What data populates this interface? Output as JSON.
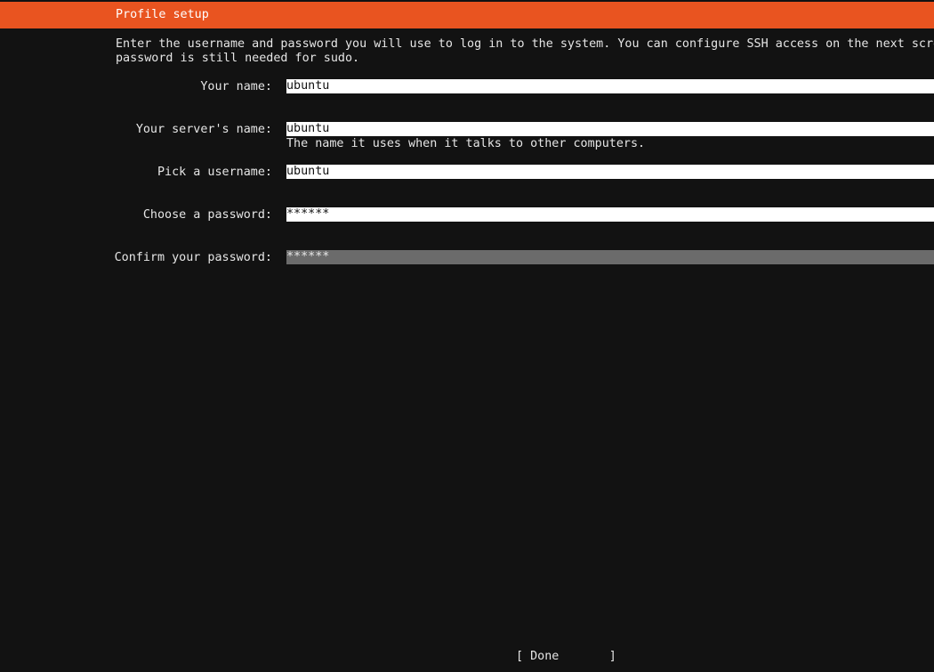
{
  "header": {
    "title": "Profile setup"
  },
  "intro": {
    "line1": "Enter the username and password you will use to log in to the system. You can configure SSH access on the next scre",
    "line2": "password is still needed for sudo."
  },
  "form": {
    "your_name": {
      "label": "Your name:",
      "value": "ubuntu"
    },
    "server_name": {
      "label": "Your server's name:",
      "value": "ubuntu",
      "help": "The name it uses when it talks to other computers."
    },
    "username": {
      "label": "Pick a username:",
      "value": "ubuntu"
    },
    "password": {
      "label": "Choose a password:",
      "value": "******"
    },
    "confirm_password": {
      "label": "Confirm your password:",
      "value": "******"
    }
  },
  "actions": {
    "done_label": "[ Done       ]"
  },
  "colors": {
    "accent": "#e95420",
    "background": "#121212",
    "field": "#ffffff",
    "field_focused": "#6b6b6b"
  }
}
